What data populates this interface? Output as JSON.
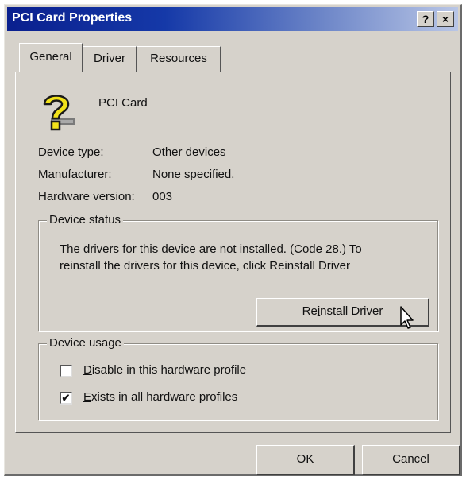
{
  "window": {
    "title": "PCI Card Properties",
    "help_glyph": "?",
    "close_glyph": "×"
  },
  "tabs": [
    {
      "label": "General",
      "active": true
    },
    {
      "label": "Driver",
      "active": false
    },
    {
      "label": "Resources",
      "active": false
    }
  ],
  "device": {
    "icon": "unknown-device-question-icon",
    "name": "PCI Card"
  },
  "properties": [
    {
      "label": "Device type:",
      "value": "Other devices"
    },
    {
      "label": "Manufacturer:",
      "value": "None specified."
    },
    {
      "label": "Hardware version:",
      "value": "003"
    }
  ],
  "device_status": {
    "legend": "Device status",
    "message_line1": "The drivers for this device are not installed. (Code 28.) To",
    "message_line2": "reinstall the drivers for this device, click Reinstall Driver",
    "reinstall_prefix": "Re",
    "reinstall_key": "i",
    "reinstall_suffix": "nstall Driver"
  },
  "device_usage": {
    "legend": "Device usage",
    "disable_key": "D",
    "disable_rest": "isable in this hardware profile",
    "disable_checked": false,
    "exists_key": "E",
    "exists_rest": "xists in all hardware profiles",
    "exists_checked": true,
    "check_glyph": "✔"
  },
  "buttons": {
    "ok": "OK",
    "cancel": "Cancel"
  },
  "colors": {
    "face": "#d6d2cb",
    "titlebar_start": "#0a1f8e",
    "icon_yellow": "#f2e21a"
  }
}
